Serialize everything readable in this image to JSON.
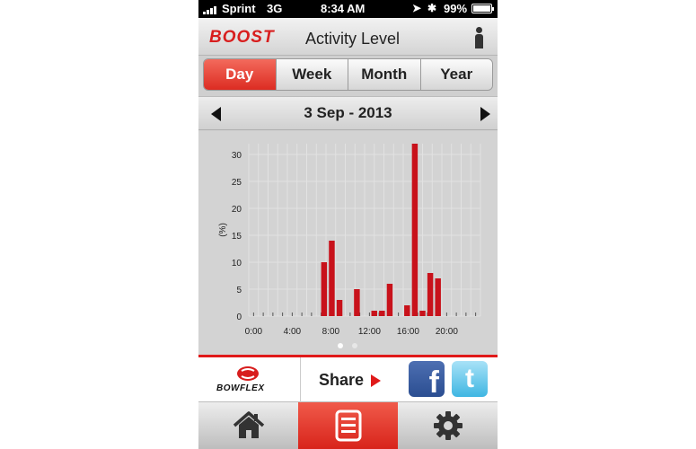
{
  "status": {
    "carrier": "Sprint",
    "network": "3G",
    "time": "8:34 AM",
    "battery": "99%",
    "battery_level": 0.99
  },
  "header": {
    "logo": "BOOST",
    "title": "Activity Level",
    "profile_icon": "person-icon"
  },
  "tabs": [
    {
      "label": "Day",
      "active": true
    },
    {
      "label": "Week",
      "active": false
    },
    {
      "label": "Month",
      "active": false
    },
    {
      "label": "Year",
      "active": false
    }
  ],
  "date": {
    "label": "3 Sep - 2013"
  },
  "chart_data": {
    "type": "bar",
    "title": "",
    "xlabel": "",
    "ylabel": "(%)",
    "ylim": [
      0,
      32
    ],
    "yticks": [
      0,
      5,
      10,
      15,
      20,
      25,
      30
    ],
    "xticks": [
      "0:00",
      "4:00",
      "8:00",
      "12:00",
      "16:00",
      "20:00"
    ],
    "xtick_hours": [
      0,
      4,
      8,
      12,
      16,
      20
    ],
    "bar_width_hours": 0.6,
    "hours": [
      7.8,
      8.6,
      9.4,
      11.2,
      13.0,
      13.8,
      14.6,
      16.4,
      17.2,
      18.0,
      18.8,
      19.6,
      20.4
    ],
    "values": [
      10,
      14,
      3,
      5,
      1,
      1,
      6,
      2,
      32,
      1,
      8,
      7,
      0
    ],
    "grid": true,
    "bar_color": "#c8121b"
  },
  "pager": {
    "pages": 2,
    "current": 0
  },
  "share": {
    "brand": "BOWFLEX",
    "label": "Share",
    "facebook": "f",
    "twitter": "t"
  },
  "nav": [
    {
      "icon": "home-icon",
      "active": false
    },
    {
      "icon": "list-icon",
      "active": true
    },
    {
      "icon": "gear-icon",
      "active": false
    }
  ],
  "colors": {
    "accent": "#dc2c22",
    "bar": "#c8121b"
  }
}
